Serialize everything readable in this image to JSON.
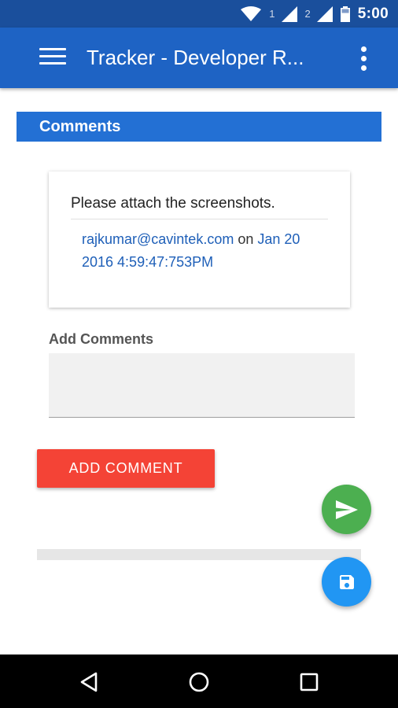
{
  "statusbar": {
    "sim1": "1",
    "sim2": "2",
    "time": "5:00"
  },
  "appbar": {
    "title": "Tracker - Developer R..."
  },
  "comments_section": {
    "header": "Comments",
    "items": [
      {
        "text": "Please attach the screenshots.",
        "author": "rajkumar@cavintek.com",
        "on_word": "on",
        "date": "Jan 20 2016 4:59:47:753PM"
      }
    ]
  },
  "add_comment": {
    "label": "Add Comments",
    "value": "",
    "button_label": "ADD COMMENT"
  },
  "icons": {
    "menu": "hamburger-menu-icon",
    "overflow": "overflow-menu-icon",
    "send": "send-icon",
    "save": "save-icon",
    "back": "back-icon",
    "home": "home-icon",
    "recents": "recents-icon"
  },
  "colors": {
    "appbar": "#1e63c4",
    "statusbar": "#1a4f9c",
    "section_header": "#2370d4",
    "add_button": "#f44336",
    "send_fab": "#4caf50",
    "save_fab": "#2196f3",
    "link": "#1e5fb8"
  }
}
